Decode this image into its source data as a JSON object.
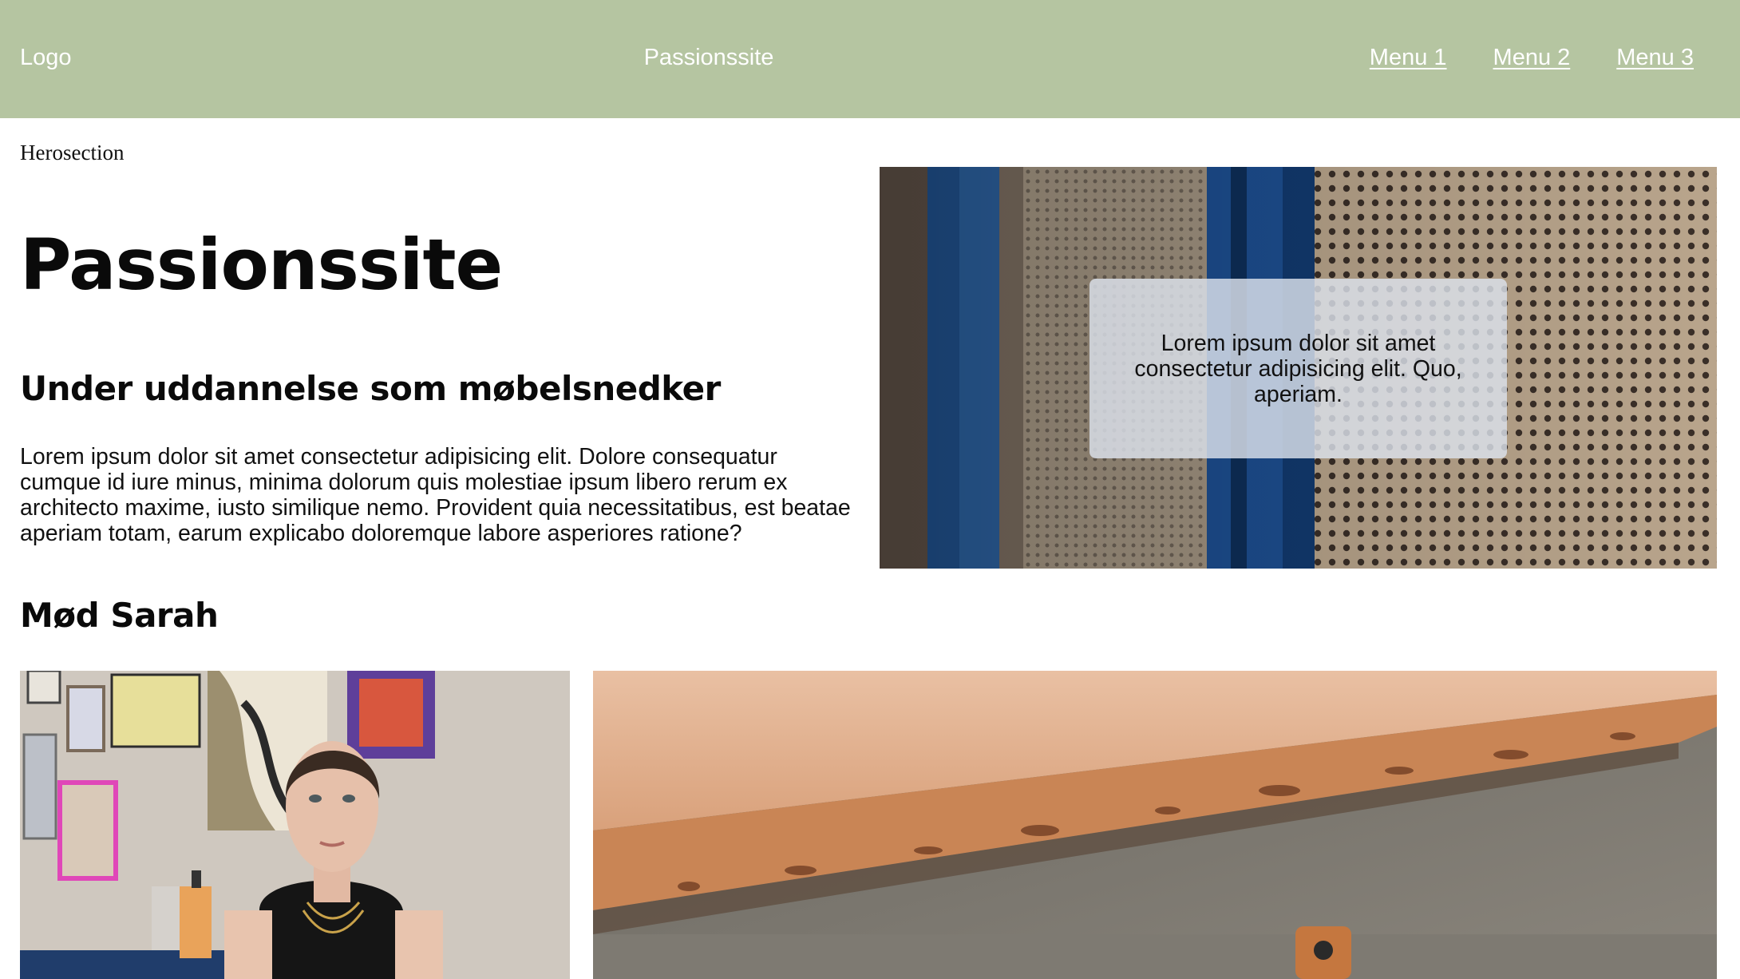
{
  "header": {
    "logo": "Logo",
    "site_name": "Passionssite",
    "menu": [
      "Menu 1",
      "Menu 2",
      "Menu 3"
    ],
    "background_color": "#b5c5a1"
  },
  "hero": {
    "label": "Herosection",
    "title": "Passionssite",
    "subtitle": "Under uddannelse som møbelsnedker",
    "text": "Lorem ipsum dolor sit amet consectetur adipisicing elit. Dolore consequatur cumque id iure minus, minima dolorum quis molestiae ipsum libero rerum ex architecto maxime, iusto similique nemo. Provident quia necessitatibus, est beatae aperiam totam, earum explicabo doloremque labore asperiores ratione?",
    "card_text": "Lorem ipsum dolor sit amet consectetur adipisicing elit. Quo, aperiam."
  },
  "meet": {
    "title": "Mød Sarah"
  }
}
